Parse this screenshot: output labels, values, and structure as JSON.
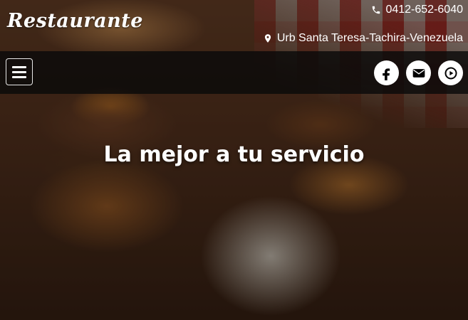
{
  "brand": {
    "name": "Restaurante"
  },
  "contact": {
    "phone": "0412-652-6040",
    "address": "Urb Santa Teresa-Tachira-Venezuela",
    "phone_icon": "phone-icon",
    "address_icon": "map-marker-icon"
  },
  "nav": {
    "menu_icon": "hamburger-menu-icon",
    "socials": [
      {
        "name": "facebook",
        "icon": "facebook-icon"
      },
      {
        "name": "email",
        "icon": "envelope-icon"
      },
      {
        "name": "youtube",
        "icon": "youtube-icon"
      }
    ]
  },
  "hero": {
    "headline": "La mejor a tu servicio"
  },
  "colors": {
    "navbar_bg": "#0a0a0a",
    "text": "#ffffff",
    "social_bg": "#ffffff",
    "social_icon": "#000000"
  }
}
